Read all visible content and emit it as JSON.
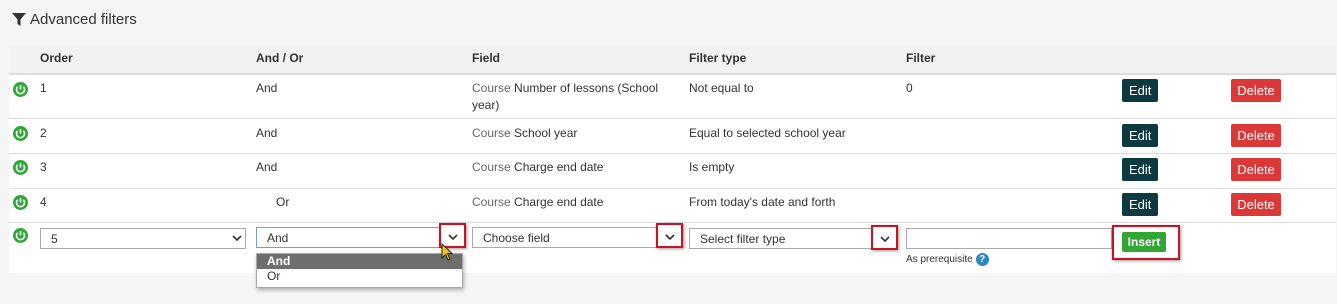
{
  "section_title": "Advanced filters",
  "headers": {
    "order": "Order",
    "and_or": "And / Or",
    "field": "Field",
    "filter_type": "Filter type",
    "filter": "Filter"
  },
  "rows": [
    {
      "order": "1",
      "and_or": "And",
      "field_prefix": "Course",
      "field": "Number of lessons (School year)",
      "filter_type": "Not equal to",
      "filter": "0"
    },
    {
      "order": "2",
      "and_or": "And",
      "field_prefix": "Course",
      "field": "School year",
      "filter_type": "Equal to selected school year",
      "filter": ""
    },
    {
      "order": "3",
      "and_or": "And",
      "field_prefix": "Course",
      "field": "Charge end date",
      "filter_type": "Is empty",
      "filter": ""
    },
    {
      "order": "4",
      "and_or": "Or",
      "field_prefix": "Course",
      "field": "Charge end date",
      "filter_type": "From today's date and forth",
      "filter": ""
    }
  ],
  "buttons": {
    "edit": "Edit",
    "delete": "Delete",
    "insert": "Insert"
  },
  "new_row": {
    "order_value": "5",
    "and_or_value": "And",
    "field_placeholder": "Choose field",
    "filter_type_placeholder": "Select filter type",
    "filter_value": "",
    "prerequisite_label": "As prerequisite",
    "help_mark": "?",
    "and_or_options": [
      "And",
      "Or"
    ],
    "selected_option": "And"
  },
  "colors": {
    "power": "#2ea836",
    "edit": "#0c3a40",
    "delete": "#dc3838",
    "insert": "#33a532",
    "highlight": "#d01020"
  }
}
